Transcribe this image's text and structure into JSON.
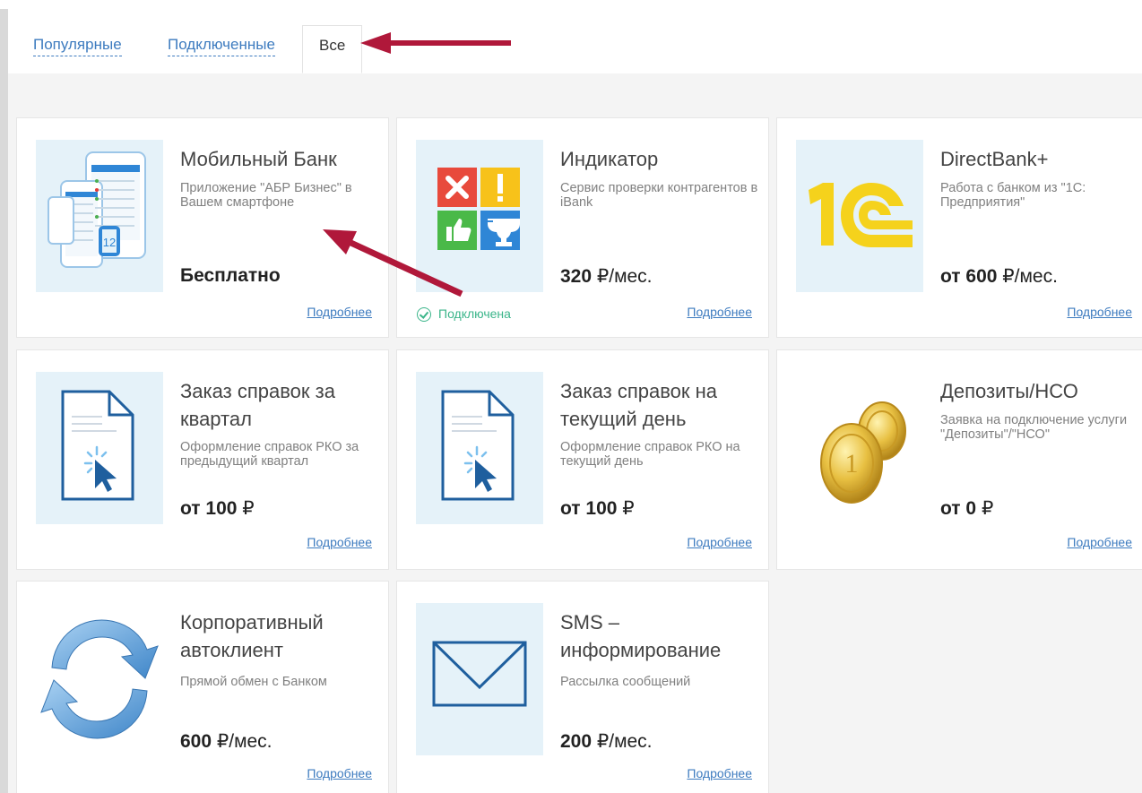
{
  "tabs": [
    {
      "label": "Популярные"
    },
    {
      "label": "Подключенные"
    },
    {
      "label": "Все"
    }
  ],
  "cards": [
    {
      "title": "Мобильный Банк",
      "desc": "Приложение \"АБР Бизнес\" в Вашем смартфоне",
      "price_bold": "Бесплатно",
      "price_rest": "",
      "more": "Подробнее",
      "icon": "mobile-app-icon"
    },
    {
      "title": "Индикатор",
      "desc": "Сервис проверки контрагентов в iBank",
      "price_bold": "320 ",
      "price_rest": "₽/мес.",
      "more": "Подробнее",
      "icon": "indicator-icon",
      "status": "Подключена"
    },
    {
      "title": "DirectBank+",
      "desc": "Работа с банком из \"1С: Предприятия\"",
      "price_bold": "от 600 ",
      "price_rest": "₽/мес.",
      "more": "Подробнее",
      "icon": "1c-logo-icon"
    },
    {
      "title": "Заказ справок за квартал",
      "desc": "Оформление справок РКО за предыдущий квартал",
      "price_bold": "от 100 ",
      "price_rest": "₽",
      "more": "Подробнее",
      "icon": "document-click-icon"
    },
    {
      "title": "Заказ справок на текущий день",
      "desc": "Оформление справок РКО на текущий день",
      "price_bold": "от 100 ",
      "price_rest": "₽",
      "more": "Подробнее",
      "icon": "document-click-icon"
    },
    {
      "title": "Депозиты/НСО",
      "desc": "Заявка на подключение услуги \"Депозиты\"/\"НСО\"",
      "price_bold": "от 0 ",
      "price_rest": "₽",
      "more": "Подробнее",
      "icon": "coins-icon"
    },
    {
      "title": "Корпоративный автоклиент",
      "desc": "Прямой обмен с Банком",
      "price_bold": "600 ",
      "price_rest": "₽/мес.",
      "more": "Подробнее",
      "icon": "sync-arrows-icon"
    },
    {
      "title": "SMS – информирование",
      "desc": "Рассылка сообщений",
      "price_bold": "200 ",
      "price_rest": "₽/мес.",
      "more": "Подробнее",
      "icon": "envelope-icon"
    }
  ],
  "colors": {
    "link": "#3d7bbf",
    "accent_arrow": "#b0183a",
    "connected": "#3bb58a",
    "thumb_bg": "#e5f2f9"
  }
}
